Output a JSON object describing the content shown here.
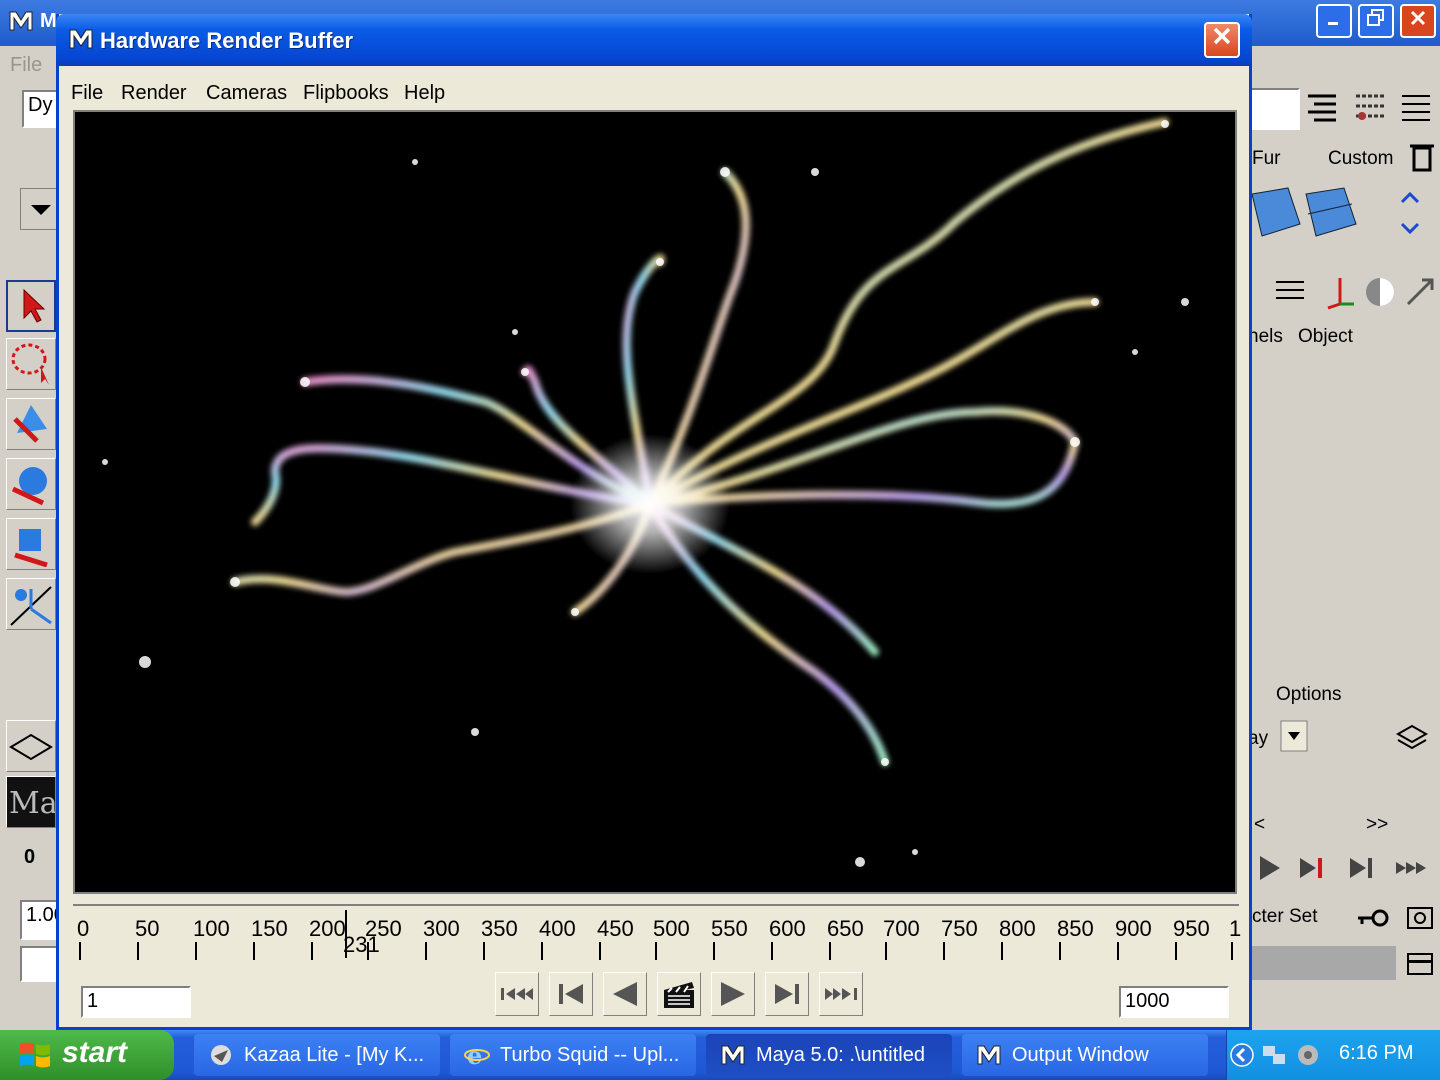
{
  "maya": {
    "title": "M",
    "menu_file": "File",
    "field_dy": "Dy",
    "left_time_field": "0",
    "left_value_field": "1.00"
  },
  "right_panel": {
    "tab_fur": "Fur",
    "tab_custom": "Custom",
    "channels_label": "nels",
    "object_label": "Object",
    "options_label": "Options",
    "display_label": "ay",
    "nav_prev": "<",
    "nav_next": ">>",
    "character_set": "cter Set"
  },
  "hrb": {
    "title": "Hardware Render Buffer",
    "menus": [
      "File",
      "Render",
      "Cameras",
      "Flipbooks",
      "Help"
    ],
    "ticks": [
      "0",
      "50",
      "100",
      "150",
      "200",
      "250",
      "300",
      "350",
      "400",
      "450",
      "500",
      "550",
      "600",
      "650",
      "700",
      "750",
      "800",
      "850",
      "900",
      "950",
      "1"
    ],
    "current_frame": "231",
    "start_frame": "1",
    "end_frame": "1000"
  },
  "taskbar": {
    "start": "start",
    "tasks": [
      {
        "label": "Kazaa Lite - [My K...",
        "icon": "kazaa-icon"
      },
      {
        "label": "Turbo Squid -- Upl...",
        "icon": "ie-icon"
      },
      {
        "label": "Maya 5.0: .\\untitled",
        "icon": "maya-icon"
      },
      {
        "label": "Output Window",
        "icon": "maya-icon"
      }
    ],
    "clock": "6:16 PM"
  },
  "colors": {
    "xp_blue": "#0a5ce6",
    "window_face": "#ece9d8",
    "close_red": "#d9461e",
    "viewport_bg": "#000000"
  }
}
